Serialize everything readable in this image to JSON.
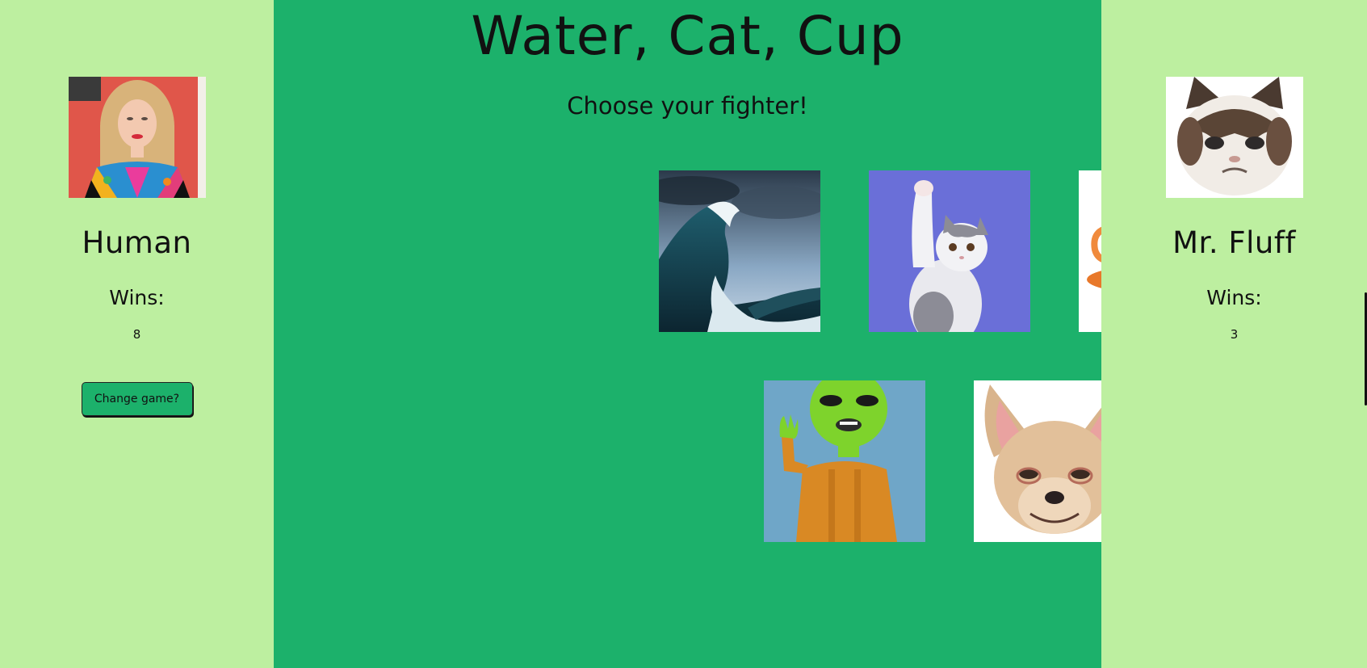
{
  "game": {
    "title": "Water, Cat, Cup",
    "subtitle": "Choose your fighter!"
  },
  "player": {
    "name": "Human",
    "wins_label": "Wins:",
    "wins": "8",
    "change_button": "Change game?"
  },
  "opponent": {
    "name": "Mr. Fluff",
    "wins_label": "Wins:",
    "wins": "3"
  },
  "fighters": [
    {
      "name": "water",
      "icon": "wave-image"
    },
    {
      "name": "cat",
      "icon": "cat-image"
    },
    {
      "name": "cup",
      "icon": "cup-image"
    },
    {
      "name": "alien",
      "icon": "alien-image"
    },
    {
      "name": "dog",
      "icon": "chihuahua-image"
    }
  ],
  "colors": {
    "side_panel": "#bdefa0",
    "main_panel": "#1cb16b",
    "text": "#111111"
  }
}
